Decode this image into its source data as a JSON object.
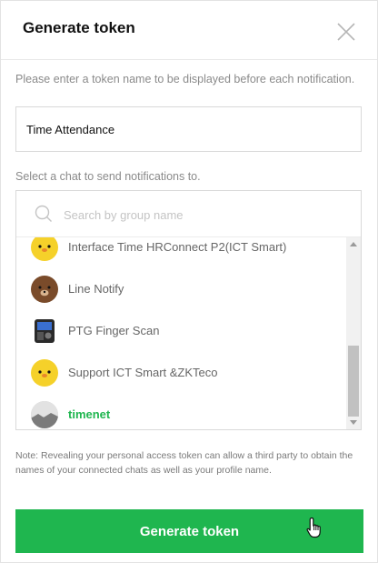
{
  "dialog": {
    "title": "Generate token",
    "close_icon": "close-icon"
  },
  "token_name": {
    "label": "Please enter a token name to be displayed before each notification.",
    "value": "Time Attendance"
  },
  "chat_select": {
    "label": "Select a chat to send notifications to.",
    "search_placeholder": "Search by group name",
    "items": [
      {
        "label": "Interface Time HRConnect P2(ICT Smart)",
        "avatar": "yellow-chick-avatar",
        "selected": false
      },
      {
        "label": "Line Notify",
        "avatar": "brown-bear-avatar",
        "selected": false
      },
      {
        "label": "PTG Finger Scan",
        "avatar": "fingerprint-scanner-avatar",
        "selected": false
      },
      {
        "label": "Support ICT Smart &ZKTeco",
        "avatar": "yellow-chick-avatar",
        "selected": false
      },
      {
        "label": "timenet",
        "avatar": "gray-landscape-avatar",
        "selected": true
      }
    ]
  },
  "note": "Note: Revealing your personal access token can allow a third party to obtain the names of your connected chats as well as your profile name.",
  "generate_button": "Generate token",
  "colors": {
    "accent": "#1fb64f",
    "selected_text": "#1fb64f",
    "label_text": "#8a8a8a"
  }
}
